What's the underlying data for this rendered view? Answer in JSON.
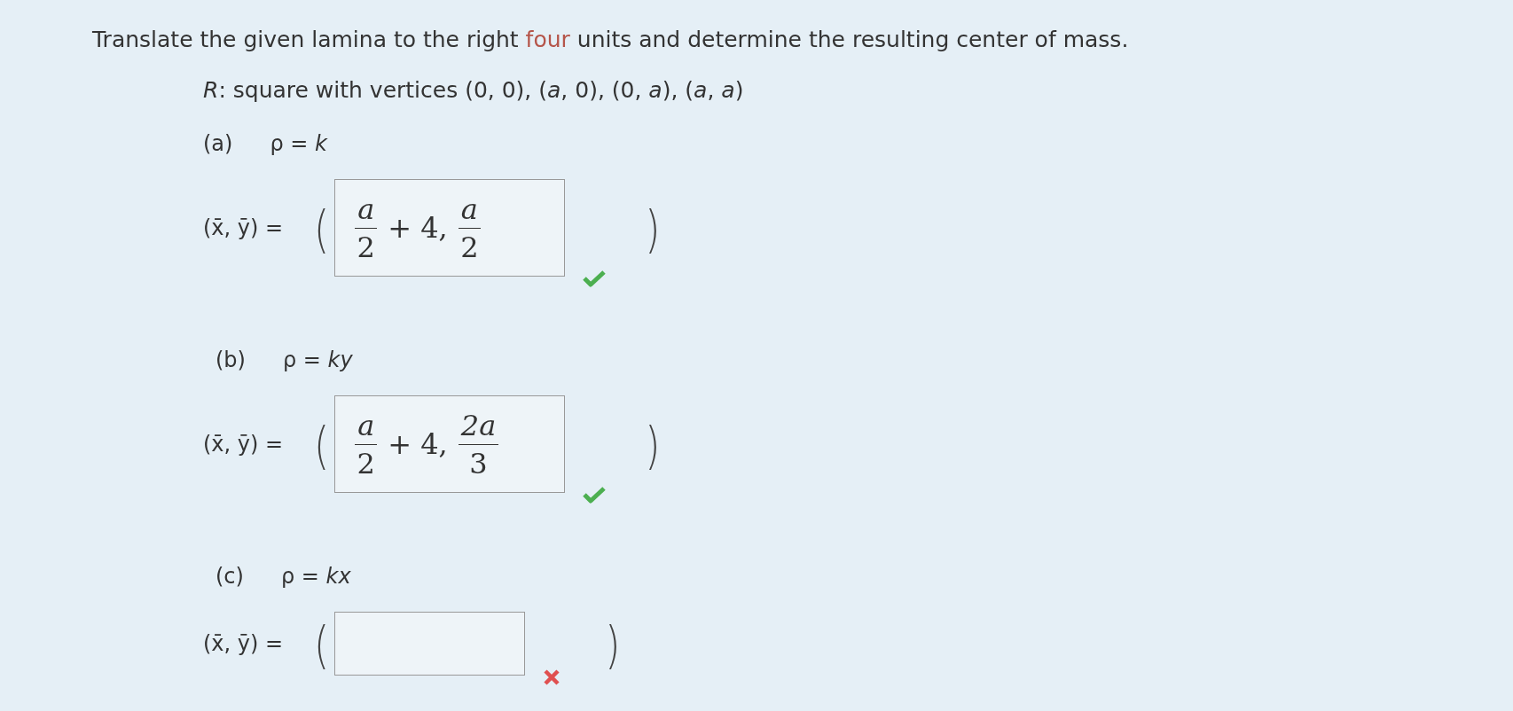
{
  "question": {
    "before": "Translate the given lamina to the right ",
    "highlight": "four",
    "after": " units and determine the resulting center of mass."
  },
  "region": "*R*: square with vertices (0, 0), (*a*, 0), (0, *a*), (*a*, *a*)",
  "parts": [
    {
      "label": "(a)",
      "density": "ρ = *k*",
      "lhs": "(x̄, ȳ) =",
      "open": "(",
      "close": ")",
      "correct": true,
      "answer": [
        {
          "kind": "fraction",
          "numerator": "a",
          "denominator": "2"
        },
        {
          "kind": "text",
          "text": "+ 4,"
        },
        {
          "kind": "fraction",
          "numerator": "a",
          "denominator": "2"
        }
      ]
    },
    {
      "label": "(b)",
      "density": "ρ = *ky*",
      "lhs": "(x̄, ȳ) =",
      "open": "(",
      "close": ")",
      "correct": true,
      "answer": [
        {
          "kind": "fraction",
          "numerator": "a",
          "denominator": "2"
        },
        {
          "kind": "text",
          "text": "+ 4,"
        },
        {
          "kind": "fraction",
          "numerator": "2a",
          "denominator": "3"
        }
      ]
    },
    {
      "label": "(c)",
      "density": "ρ = *kx*",
      "lhs": "(x̄, ȳ) =",
      "open": "(",
      "close": ")",
      "correct": false
    }
  ]
}
